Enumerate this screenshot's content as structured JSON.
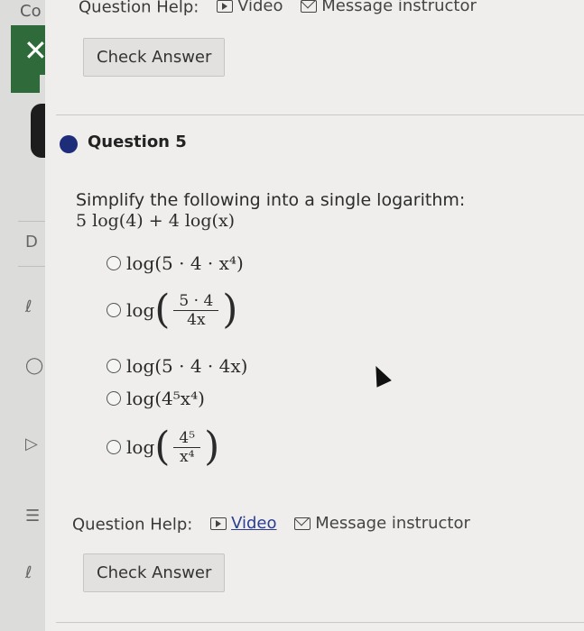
{
  "sidebar": {
    "top_text": "Co",
    "close_label": "✕",
    "icons": [
      "D",
      "ℓ",
      "◯",
      "▷",
      "☰",
      "ℓ"
    ]
  },
  "top": {
    "help_label": "Question Help:",
    "video_label": "Video",
    "message_label": "Message instructor",
    "check_answer": "Check Answer"
  },
  "question": {
    "title": "Question 5",
    "prompt": "Simplify the following into a single logarithm:",
    "expression": "5 log(4) + 4 log(x)"
  },
  "options": [
    {
      "prefix": "log(",
      "body": "5 · 4 · x⁴",
      "suffix": ")"
    },
    {
      "prefix": "log",
      "num": "5 · 4",
      "den": "4x"
    },
    {
      "prefix": "log(",
      "body": "5 · 4 · 4x",
      "suffix": ")"
    },
    {
      "prefix": "log(",
      "body": "4⁵x⁴",
      "suffix": ")"
    },
    {
      "prefix": "log",
      "num": "4⁵",
      "den": "x⁴"
    }
  ],
  "bottom": {
    "help_label": "Question Help:",
    "video_label": "Video",
    "message_label": "Message instructor",
    "check_answer": "Check Answer"
  },
  "colors": {
    "close_tab": "#2f6a3a",
    "question_dot": "#1e2d7a",
    "link": "#2a3d8f"
  }
}
